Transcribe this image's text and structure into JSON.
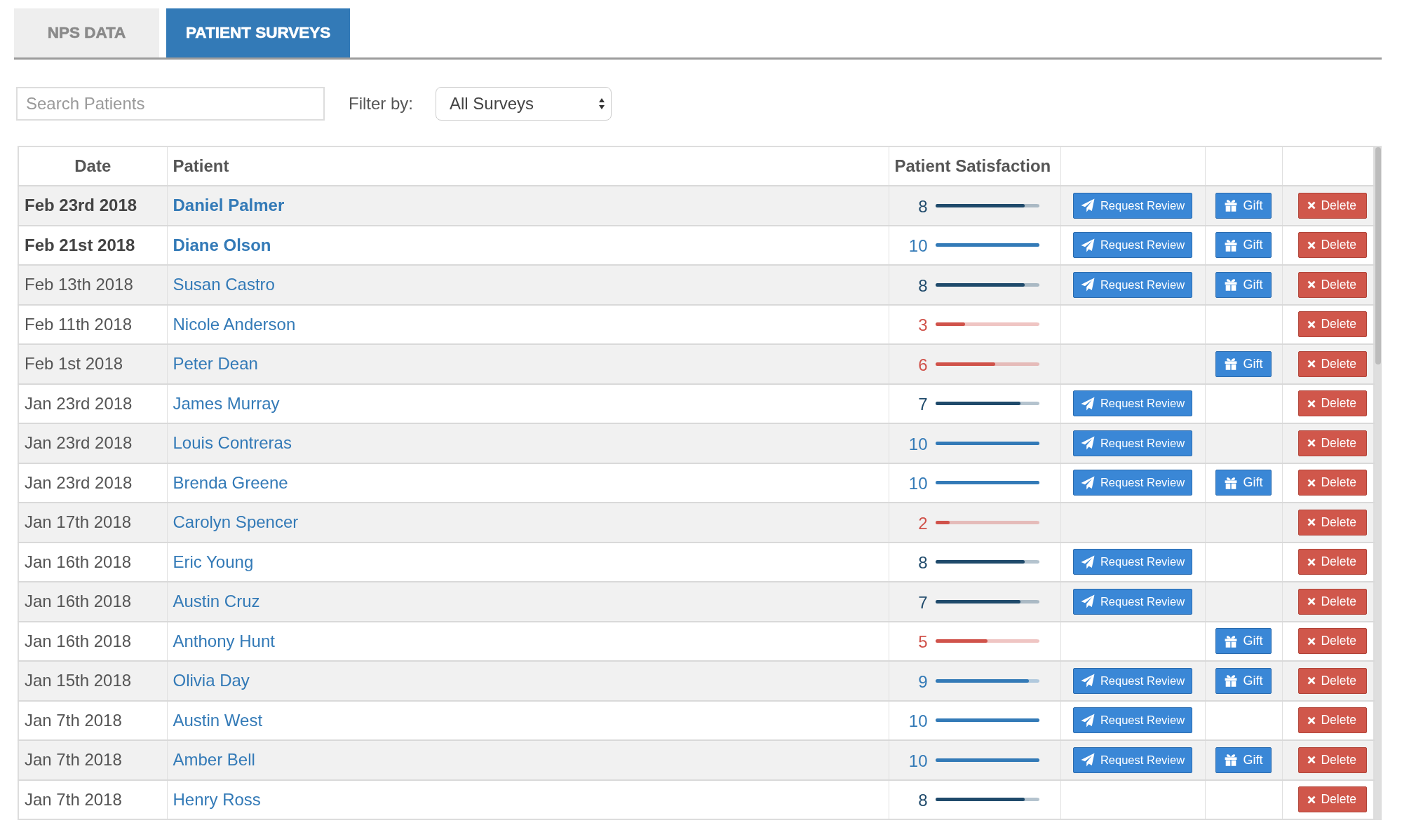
{
  "tabs": [
    {
      "label": "NPS DATA",
      "selected": false
    },
    {
      "label": "PATIENT SURVEYS",
      "selected": true
    }
  ],
  "search": {
    "placeholder": "Search Patients"
  },
  "filter": {
    "label": "Filter by:",
    "value": "All Surveys"
  },
  "table": {
    "columns": [
      "Date",
      "Patient",
      "Patient Satisfaction"
    ],
    "rows": [
      {
        "date": "Feb 23rd 2018",
        "patient": "Daniel Palmer",
        "unread": true,
        "score": "8",
        "level": 0.86,
        "color": "#1f4a6b",
        "actions": [
          {
            "kind": "review",
            "label": "Request Review"
          },
          {
            "kind": "gift",
            "label": "Gift"
          },
          {
            "kind": "delete",
            "label": "Delete"
          }
        ]
      },
      {
        "date": "Feb 21st 2018",
        "patient": "Diane Olson",
        "unread": true,
        "score": "10",
        "level": 1,
        "color": "#337ab7",
        "actions": [
          {
            "kind": "review",
            "label": "Request Review"
          },
          {
            "kind": "gift",
            "label": "Gift"
          },
          {
            "kind": "delete",
            "label": "Delete"
          }
        ]
      },
      {
        "date": "Feb 13th 2018",
        "patient": "Susan Castro",
        "unread": false,
        "score": "8",
        "level": 0.86,
        "color": "#1f4a6b",
        "actions": [
          {
            "kind": "review",
            "label": "Request Review"
          },
          {
            "kind": "gift",
            "label": "Gift"
          },
          {
            "kind": "delete",
            "label": "Delete"
          }
        ]
      },
      {
        "date": "Feb 11th 2018",
        "patient": "Nicole Anderson",
        "unread": false,
        "score": "3",
        "level": 0.29,
        "color": "#d0524a",
        "actions": [
          {
            "kind": "delete",
            "label": "Delete"
          }
        ]
      },
      {
        "date": "Feb 1st 2018",
        "patient": "Peter Dean",
        "unread": false,
        "score": "6",
        "level": 0.58,
        "color": "#d0524a",
        "actions": [
          {
            "kind": "gift",
            "label": "Gift"
          },
          {
            "kind": "delete",
            "label": "Delete"
          }
        ]
      },
      {
        "date": "Jan 23rd 2018",
        "patient": "James Murray",
        "unread": false,
        "score": "7",
        "level": 0.82,
        "color": "#1f4a6b",
        "actions": [
          {
            "kind": "review",
            "label": "Request Review"
          },
          {
            "kind": "delete",
            "label": "Delete"
          }
        ]
      },
      {
        "date": "Jan 23rd 2018",
        "patient": "Louis Contreras",
        "unread": false,
        "score": "10",
        "level": 1,
        "color": "#337ab7",
        "actions": [
          {
            "kind": "review",
            "label": "Request Review"
          },
          {
            "kind": "delete",
            "label": "Delete"
          }
        ]
      },
      {
        "date": "Jan 23rd 2018",
        "patient": "Brenda Greene",
        "unread": false,
        "score": "10",
        "level": 1,
        "color": "#337ab7",
        "actions": [
          {
            "kind": "review",
            "label": "Request Review"
          },
          {
            "kind": "gift",
            "label": "Gift"
          },
          {
            "kind": "delete",
            "label": "Delete"
          }
        ]
      },
      {
        "date": "Jan 17th 2018",
        "patient": "Carolyn Spencer",
        "unread": false,
        "score": "2",
        "level": 0.14,
        "color": "#d0524a",
        "actions": [
          {
            "kind": "delete",
            "label": "Delete"
          }
        ]
      },
      {
        "date": "Jan 16th 2018",
        "patient": "Eric Young",
        "unread": false,
        "score": "8",
        "level": 0.86,
        "color": "#1f4a6b",
        "actions": [
          {
            "kind": "review",
            "label": "Request Review"
          },
          {
            "kind": "delete",
            "label": "Delete"
          }
        ]
      },
      {
        "date": "Jan 16th 2018",
        "patient": "Austin Cruz",
        "unread": false,
        "score": "7",
        "level": 0.82,
        "color": "#1f4a6b",
        "actions": [
          {
            "kind": "review",
            "label": "Request Review"
          },
          {
            "kind": "delete",
            "label": "Delete"
          }
        ]
      },
      {
        "date": "Jan 16th 2018",
        "patient": "Anthony Hunt",
        "unread": false,
        "score": "5",
        "level": 0.5,
        "color": "#d0524a",
        "actions": [
          {
            "kind": "gift",
            "label": "Gift"
          },
          {
            "kind": "delete",
            "label": "Delete"
          }
        ]
      },
      {
        "date": "Jan 15th 2018",
        "patient": "Olivia Day",
        "unread": false,
        "score": "9",
        "level": 0.9,
        "color": "#337ab7",
        "actions": [
          {
            "kind": "review",
            "label": "Request Review"
          },
          {
            "kind": "gift",
            "label": "Gift"
          },
          {
            "kind": "delete",
            "label": "Delete"
          }
        ]
      },
      {
        "date": "Jan 7th 2018",
        "patient": "Austin West",
        "unread": false,
        "score": "10",
        "level": 1,
        "color": "#337ab7",
        "actions": [
          {
            "kind": "review",
            "label": "Request Review"
          },
          {
            "kind": "delete",
            "label": "Delete"
          }
        ]
      },
      {
        "date": "Jan 7th 2018",
        "patient": "Amber Bell",
        "unread": false,
        "score": "10",
        "level": 1,
        "color": "#337ab7",
        "actions": [
          {
            "kind": "review",
            "label": "Request Review"
          },
          {
            "kind": "gift",
            "label": "Gift"
          },
          {
            "kind": "delete",
            "label": "Delete"
          }
        ]
      },
      {
        "date": "Jan 7th 2018",
        "patient": "Henry Ross",
        "unread": false,
        "score": "8",
        "level": 0.86,
        "color": "#1f4a6b",
        "actions": [
          {
            "kind": "delete",
            "label": "Delete"
          }
        ]
      }
    ]
  }
}
